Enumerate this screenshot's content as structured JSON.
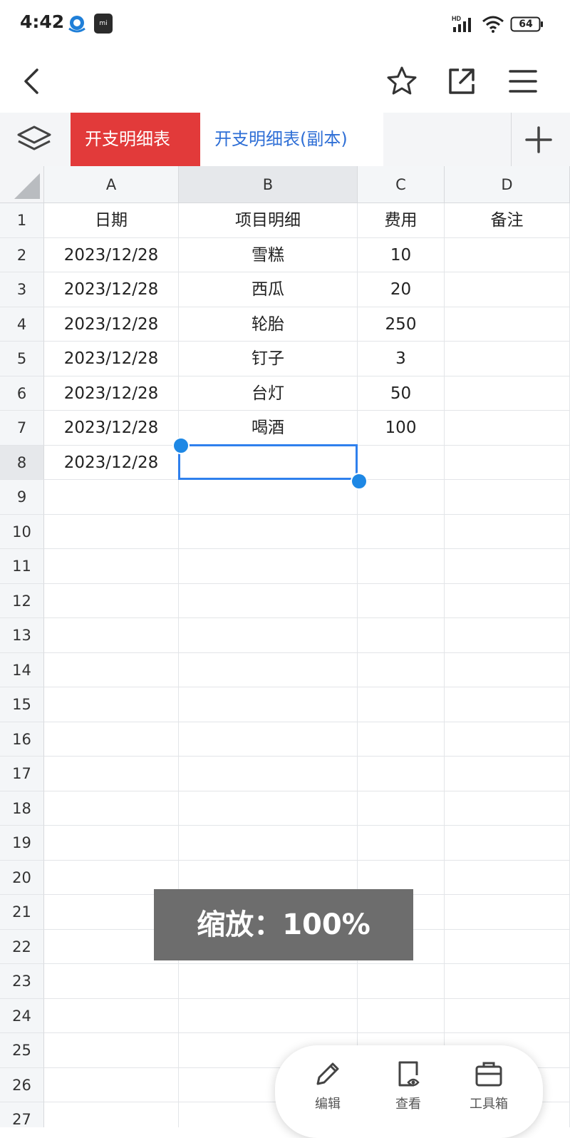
{
  "status_bar": {
    "time": "4:42",
    "network": "HD",
    "battery": "64"
  },
  "sheet_tabs": [
    {
      "label": "开支明细表",
      "active": true
    },
    {
      "label": "开支明细表(副本)",
      "active": false
    }
  ],
  "columns": [
    "A",
    "B",
    "C",
    "D"
  ],
  "rows": [
    {
      "num": "1",
      "cells": [
        "日期",
        "项目明细",
        "费用",
        "备注"
      ]
    },
    {
      "num": "2",
      "cells": [
        "2023/12/28",
        "雪糕",
        "10",
        ""
      ]
    },
    {
      "num": "3",
      "cells": [
        "2023/12/28",
        "西瓜",
        "20",
        ""
      ]
    },
    {
      "num": "4",
      "cells": [
        "2023/12/28",
        "轮胎",
        "250",
        ""
      ]
    },
    {
      "num": "5",
      "cells": [
        "2023/12/28",
        "钉子",
        "3",
        ""
      ]
    },
    {
      "num": "6",
      "cells": [
        "2023/12/28",
        "台灯",
        "50",
        ""
      ]
    },
    {
      "num": "7",
      "cells": [
        "2023/12/28",
        "喝酒",
        "100",
        ""
      ]
    },
    {
      "num": "8",
      "cells": [
        "2023/12/28",
        "",
        "",
        ""
      ]
    },
    {
      "num": "9",
      "cells": [
        "",
        "",
        "",
        ""
      ]
    },
    {
      "num": "10",
      "cells": [
        "",
        "",
        "",
        ""
      ]
    },
    {
      "num": "11",
      "cells": [
        "",
        "",
        "",
        ""
      ]
    },
    {
      "num": "12",
      "cells": [
        "",
        "",
        "",
        ""
      ]
    },
    {
      "num": "13",
      "cells": [
        "",
        "",
        "",
        ""
      ]
    },
    {
      "num": "14",
      "cells": [
        "",
        "",
        "",
        ""
      ]
    },
    {
      "num": "15",
      "cells": [
        "",
        "",
        "",
        ""
      ]
    },
    {
      "num": "16",
      "cells": [
        "",
        "",
        "",
        ""
      ]
    },
    {
      "num": "17",
      "cells": [
        "",
        "",
        "",
        ""
      ]
    },
    {
      "num": "18",
      "cells": [
        "",
        "",
        "",
        ""
      ]
    },
    {
      "num": "19",
      "cells": [
        "",
        "",
        "",
        ""
      ]
    },
    {
      "num": "20",
      "cells": [
        "",
        "",
        "",
        ""
      ]
    },
    {
      "num": "21",
      "cells": [
        "",
        "",
        "",
        ""
      ]
    },
    {
      "num": "22",
      "cells": [
        "",
        "",
        "",
        ""
      ]
    },
    {
      "num": "23",
      "cells": [
        "",
        "",
        "",
        ""
      ]
    },
    {
      "num": "24",
      "cells": [
        "",
        "",
        "",
        ""
      ]
    },
    {
      "num": "25",
      "cells": [
        "",
        "",
        "",
        ""
      ]
    },
    {
      "num": "26",
      "cells": [
        "",
        "",
        "",
        ""
      ]
    },
    {
      "num": "27",
      "cells": [
        "",
        "",
        "",
        ""
      ]
    }
  ],
  "selected_cell": "B8",
  "toast": "缩放：100%",
  "toolbar": {
    "edit": "编辑",
    "view": "查看",
    "toolbox": "工具箱"
  },
  "colors": {
    "active_tab": "#e23a3a",
    "inactive_tab_text": "#2f6fd6",
    "selection": "#2f80ed"
  }
}
